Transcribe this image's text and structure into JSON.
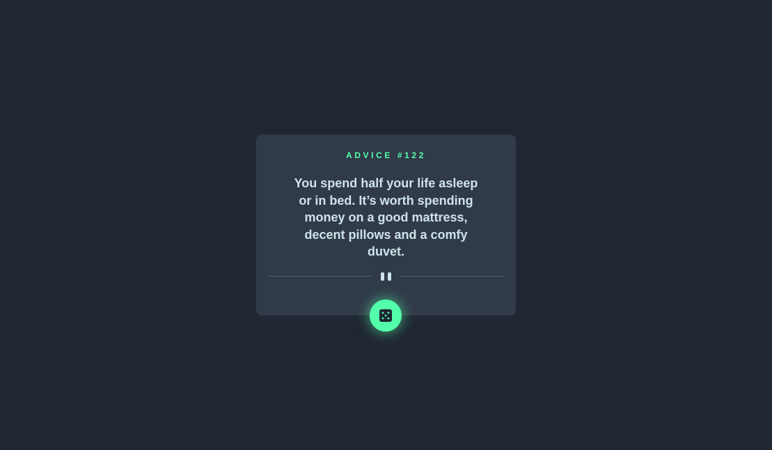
{
  "advice": {
    "label": "ADVICE #122",
    "quote": "You spend half your life asleep or in bed. It’s worth spending money on a good mattress, decent pillows and a comfy duvet."
  },
  "icons": {
    "divider": "pause-icon",
    "button": "dice-icon"
  },
  "colors": {
    "background": "#202632",
    "card": "#313a49",
    "accent": "#53ffaa",
    "text": "#cee3e9",
    "divider": "#4f5d74"
  }
}
